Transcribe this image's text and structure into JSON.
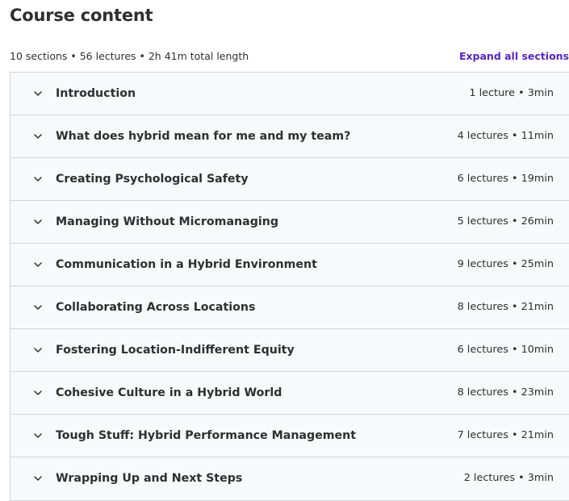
{
  "heading": "Course content",
  "summary": "10 sections • 56 lectures • 2h 41m total length",
  "expand_all_label": "Expand all sections",
  "sections": [
    {
      "title": "Introduction",
      "meta": "1 lecture • 3min"
    },
    {
      "title": "What does hybrid mean for me and my team?",
      "meta": "4 lectures • 11min"
    },
    {
      "title": "Creating Psychological Safety",
      "meta": "6 lectures • 19min"
    },
    {
      "title": "Managing Without Micromanaging",
      "meta": "5 lectures • 26min"
    },
    {
      "title": "Communication in a Hybrid Environment",
      "meta": "9 lectures • 25min"
    },
    {
      "title": "Collaborating Across Locations",
      "meta": "8 lectures • 21min"
    },
    {
      "title": "Fostering Location-Indifferent Equity",
      "meta": "6 lectures • 10min"
    },
    {
      "title": "Cohesive Culture in a Hybrid World",
      "meta": "8 lectures • 23min"
    },
    {
      "title": "Tough Stuff: Hybrid Performance Management",
      "meta": "7 lectures • 21min"
    },
    {
      "title": "Wrapping Up and Next Steps",
      "meta": "2 lectures • 3min"
    }
  ],
  "icons": {
    "section_toggle": "chevron-down-icon"
  },
  "colors": {
    "accent": "#5624d0",
    "section_bg": "#f7f9fa",
    "border": "#d1d7dc",
    "text": "#2d2f31"
  }
}
